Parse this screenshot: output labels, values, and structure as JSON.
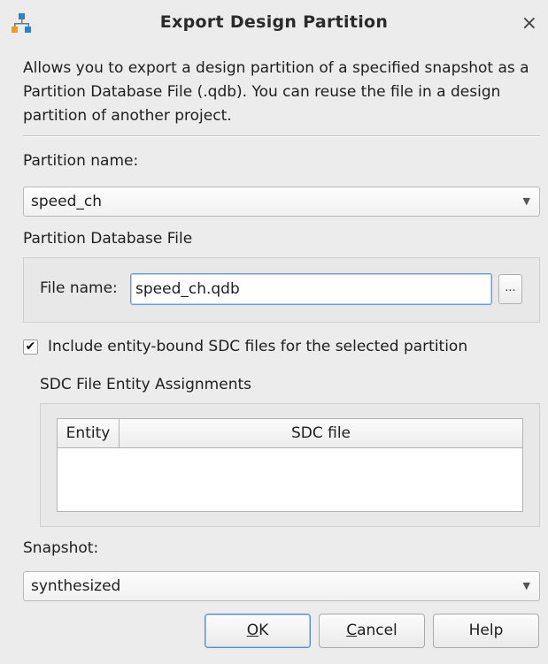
{
  "window": {
    "title": "Export Design Partition",
    "close_glyph": "×",
    "icon": "app-network-icon"
  },
  "description": "Allows you to export a design partition of a specified snapshot as a Partition Database File (.qdb). You can reuse the file in a design partition of another project.",
  "partition": {
    "label": "Partition name:",
    "value": "speed_ch"
  },
  "database_file": {
    "group_label": "Partition Database File",
    "file_label": "File name:",
    "file_value": "speed_ch.qdb",
    "browse_label": "..."
  },
  "include_sdc": {
    "checked": true,
    "check_glyph": "✔",
    "label": "Include entity-bound SDC files for the selected partition"
  },
  "sdc_assignments": {
    "group_label": "SDC File Entity Assignments",
    "columns": [
      "Entity",
      "SDC file"
    ],
    "rows": []
  },
  "snapshot": {
    "label": "Snapshot:",
    "value": "synthesized"
  },
  "buttons": {
    "ok_mnemonic": "O",
    "ok_rest": "K",
    "cancel_mnemonic": "C",
    "cancel_rest": "ancel",
    "help": "Help"
  },
  "colors": {
    "icon_orange": "#f39c12",
    "icon_blue": "#2f7fd0",
    "focus_blue": "#5a8cc6"
  }
}
